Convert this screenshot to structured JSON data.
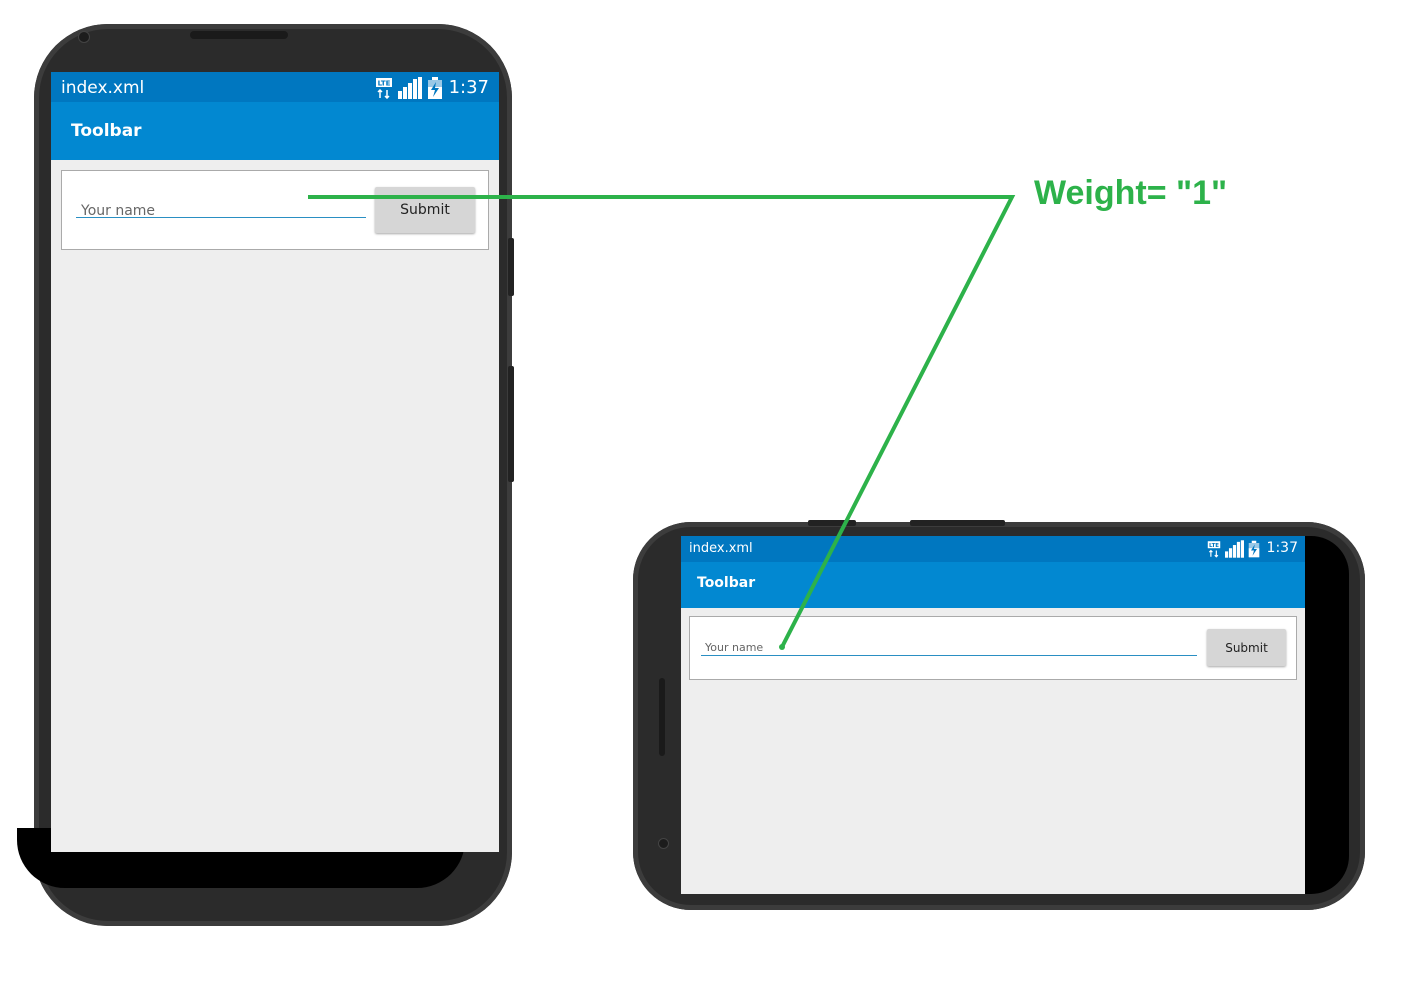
{
  "portrait": {
    "status_title": "index.xml",
    "status_time": "1:37",
    "toolbar_title": "Toolbar",
    "input_placeholder": "Your name",
    "submit_label": "Submit"
  },
  "landscape": {
    "status_title": "index.xml",
    "status_time": "1:37",
    "toolbar_title": "Toolbar",
    "input_placeholder": "Your name",
    "submit_label": "Submit"
  },
  "annotation": {
    "label": "Weight= \"1\"",
    "color": "#2db24a"
  },
  "colors": {
    "status_bar": "#0077c0",
    "toolbar": "#0288d1",
    "screen_bg": "#eeeeee",
    "input_underline": "#2a8fc3",
    "phone_body": "#2b2b2b"
  }
}
